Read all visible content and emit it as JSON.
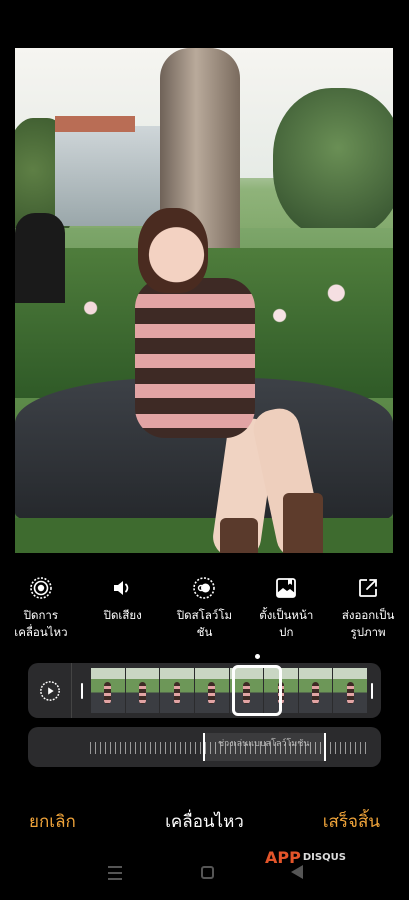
{
  "actions": [
    {
      "icon": "motion-off-icon",
      "label": "ปิดการ\nเคลื่อนไหว"
    },
    {
      "icon": "speaker-icon",
      "label": "ปิดเสียง"
    },
    {
      "icon": "slow-motion-icon",
      "label": "ปิดสโลว์โม\nชัน"
    },
    {
      "icon": "cover-photo-icon",
      "label": "ตั้งเป็นหน้า\nปก"
    },
    {
      "icon": "export-icon",
      "label": "ส่งออกเป็น\nรูปภาพ"
    }
  ],
  "slowmo": {
    "label": "ช่วงเล่นแบบสโลว์โมชัน"
  },
  "bottom": {
    "cancel": "ยกเลิก",
    "title": "เคลื่อนไหว",
    "done": "เสร็จสิ้น"
  },
  "watermark": {
    "main": "APP",
    "side": "DISQUS"
  },
  "colors": {
    "accent": "#f0a43a",
    "background": "#000000"
  }
}
